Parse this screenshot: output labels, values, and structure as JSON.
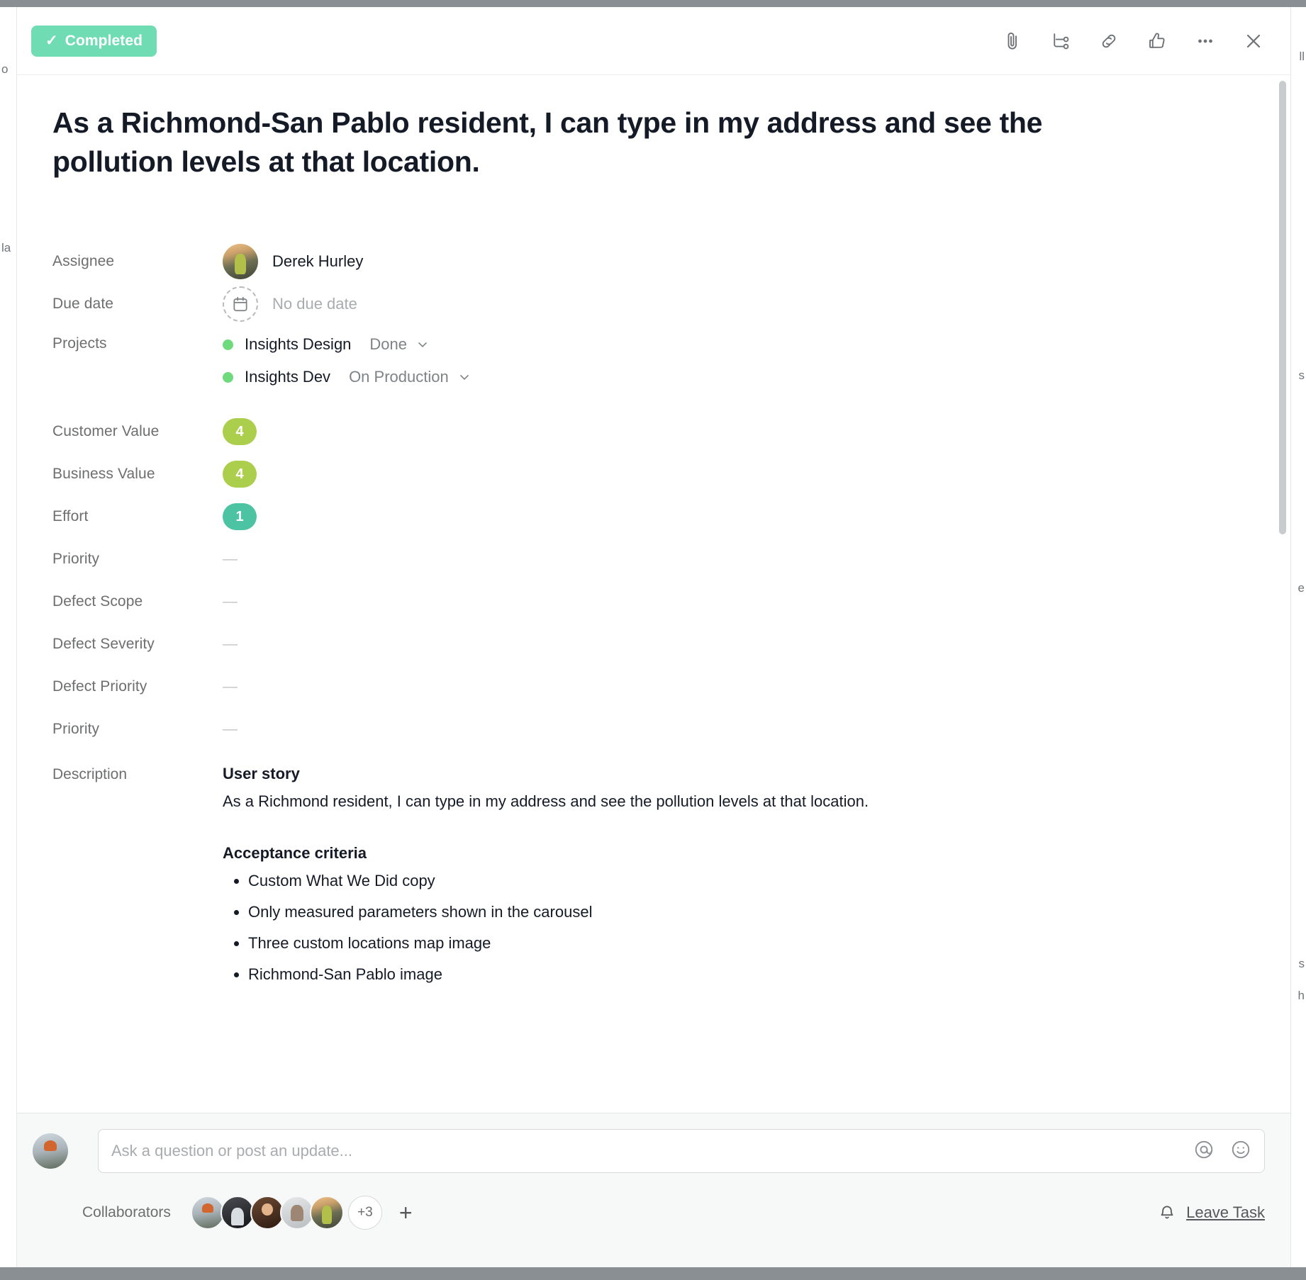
{
  "background": {
    "ghost_left_top": "o",
    "ghost_left_mid": "la",
    "ghost_right_1": "ll",
    "ghost_right_2": "s",
    "ghost_right_3": "e",
    "ghost_right_4": "s",
    "ghost_right_5": "h"
  },
  "header": {
    "status_label": "Completed",
    "status_check": "✓",
    "status_color": "#6fdcb4",
    "actions": [
      {
        "name": "attachment-icon",
        "tooltip": "Attach file"
      },
      {
        "name": "subtask-icon",
        "tooltip": "Add subtask"
      },
      {
        "name": "link-icon",
        "tooltip": "Copy task link"
      },
      {
        "name": "like-icon",
        "tooltip": "Like"
      },
      {
        "name": "more-icon",
        "tooltip": "More actions"
      },
      {
        "name": "close-icon",
        "tooltip": "Close details"
      }
    ]
  },
  "task": {
    "title": "As a Richmond-San Pablo resident, I can type in my address and see the pollution levels at that location."
  },
  "fields": {
    "assignee": {
      "label": "Assignee",
      "value": "Derek Hurley"
    },
    "due_date": {
      "label": "Due date",
      "value": "No due date"
    },
    "projects": {
      "label": "Projects",
      "items": [
        {
          "name": "Insights Design",
          "status": "Done",
          "dot_color": "#6fda7c"
        },
        {
          "name": "Insights Dev",
          "status": "On Production",
          "dot_color": "#6fda7c"
        }
      ]
    },
    "custom": [
      {
        "label": "Customer Value",
        "value": "4",
        "type": "pill",
        "color": "#abcf4c"
      },
      {
        "label": "Business Value",
        "value": "4",
        "type": "pill",
        "color": "#abcf4c"
      },
      {
        "label": "Effort",
        "value": "1",
        "type": "pill",
        "color": "#4cc4a4"
      },
      {
        "label": "Priority",
        "value": "—",
        "type": "empty"
      },
      {
        "label": "Defect Scope",
        "value": "—",
        "type": "empty"
      },
      {
        "label": "Defect Severity",
        "value": "—",
        "type": "empty"
      },
      {
        "label": "Defect Priority",
        "value": "—",
        "type": "empty"
      },
      {
        "label": "Priority",
        "value": "—",
        "type": "empty"
      }
    ]
  },
  "description": {
    "label": "Description",
    "user_story_heading": "User story",
    "user_story_body": "As a Richmond resident, I can type in my address and see the pollution levels at that location.",
    "acceptance_heading": "Acceptance criteria",
    "acceptance_items": [
      "Custom What We Did copy",
      "Only measured parameters shown in the carousel",
      "Three custom locations map image",
      "Richmond-San Pablo image"
    ]
  },
  "footer": {
    "comment_placeholder": "Ask a question or post an update...",
    "mention_icon": "@",
    "emoji_icon": "☺",
    "collaborators_label": "Collaborators",
    "collaborator_overflow": "+3",
    "add_collaborator": "+",
    "leave_task_label": "Leave Task"
  }
}
